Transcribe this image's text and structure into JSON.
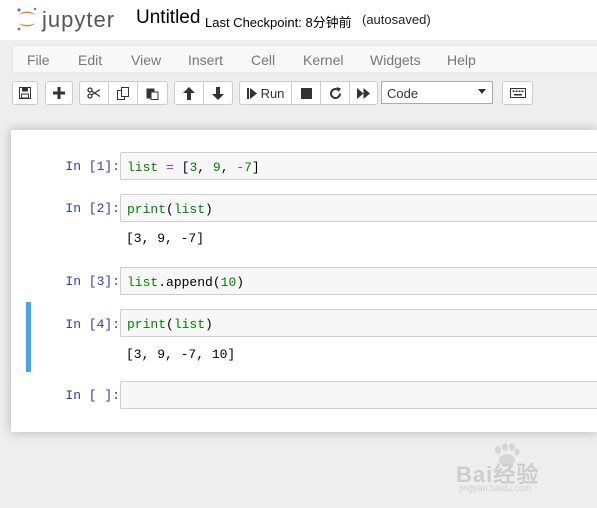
{
  "header": {
    "logo_text": "jupyter",
    "notebook_title": "Untitled",
    "checkpoint": "Last Checkpoint: 8分钟前",
    "autosave_status": "(autosaved)"
  },
  "menu": {
    "items": [
      "File",
      "Edit",
      "View",
      "Insert",
      "Cell",
      "Kernel",
      "Widgets",
      "Help"
    ]
  },
  "toolbar": {
    "save_icon": "floppy-disk-icon",
    "add_icon": "plus-icon",
    "cut_icon": "scissors-icon",
    "copy_icon": "copy-icon",
    "paste_icon": "paste-icon",
    "move_up_icon": "arrow-up-icon",
    "move_down_icon": "arrow-down-icon",
    "run_label": "Run",
    "stop_icon": "stop-icon",
    "restart_icon": "restart-icon",
    "fast_forward_icon": "fast-forward-icon",
    "cell_type": "Code",
    "keyboard_icon": "keyboard-icon"
  },
  "cells": [
    {
      "prompt": "In [1]:",
      "code": "list = [3, 9, -7]",
      "output": ""
    },
    {
      "prompt": "In [2]:",
      "code": "print(list)",
      "output": "[3, 9, -7]"
    },
    {
      "prompt": "In [3]:",
      "code": "list.append(10)",
      "output": ""
    },
    {
      "prompt": "In [4]:",
      "code": "print(list)",
      "output": "[3, 9, -7, 10]"
    },
    {
      "prompt": "In [ ]:",
      "code": "",
      "output": ""
    }
  ],
  "watermark": {
    "text": "Bai经验",
    "url": "jingyan.baidu.com"
  },
  "colors": {
    "selected_cell_border": "#42a5f5",
    "prompt": "#303f9f",
    "keyword_green": "#008000",
    "operator_purple": "#aa22ff"
  }
}
